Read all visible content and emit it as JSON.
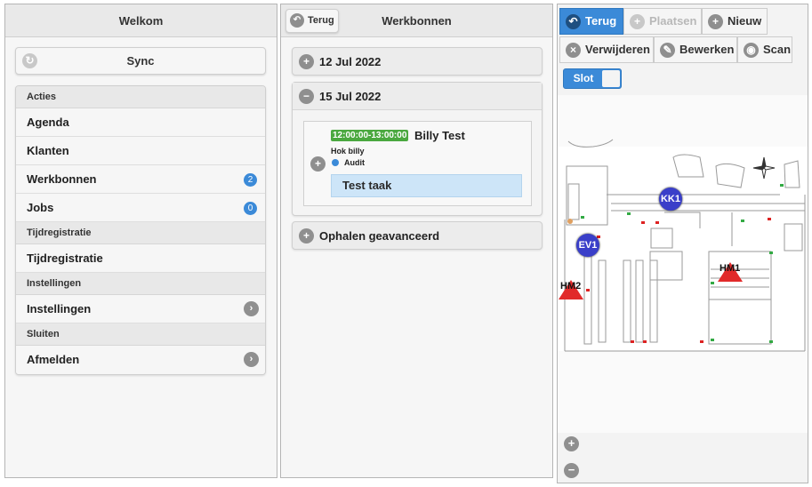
{
  "screen1": {
    "title": "Welkom",
    "sync_label": "Sync",
    "groups": [
      {
        "header": "Acties",
        "items": [
          {
            "label": "Agenda"
          },
          {
            "label": "Klanten"
          },
          {
            "label": "Werkbonnen",
            "count": "2"
          },
          {
            "label": "Jobs",
            "count": "0"
          }
        ]
      },
      {
        "header": "Tijdregistratie",
        "items": [
          {
            "label": "Tijdregistratie"
          }
        ]
      },
      {
        "header": "Instellingen",
        "items": [
          {
            "label": "Instellingen",
            "chevron": true
          }
        ]
      },
      {
        "header": "Sluiten",
        "items": [
          {
            "label": "Afmelden",
            "chevron": true
          }
        ]
      }
    ]
  },
  "screen2": {
    "back_label": "Terug",
    "title": "Werkbonnen",
    "dates": [
      "12 Jul 2022",
      "15 Jul 2022"
    ],
    "workorder": {
      "time": "12:00:00-13:00:00",
      "client": "Billy Test",
      "location": "Hok billy",
      "type": "Audit",
      "task": "Test taak"
    },
    "advanced_label": "Ophalen geavanceerd"
  },
  "screen3": {
    "toolbar": {
      "back": "Terug",
      "place": "Plaatsen",
      "new": "Nieuw",
      "delete": "Verwijderen",
      "edit": "Bewerken",
      "scan": "Scan"
    },
    "lock_label": "Slot",
    "map_markers": {
      "kk1": "KK1",
      "ev1": "EV1",
      "hm1": "HM1",
      "hm2": "HM2"
    },
    "zoom_in": "+",
    "zoom_out": "−"
  },
  "colors": {
    "accent": "#3b8ad8",
    "time_badge": "#4aa83f",
    "task_bg": "#cde5f8",
    "marker_blue": "#3a3fc9",
    "marker_red": "#e12a2a"
  }
}
